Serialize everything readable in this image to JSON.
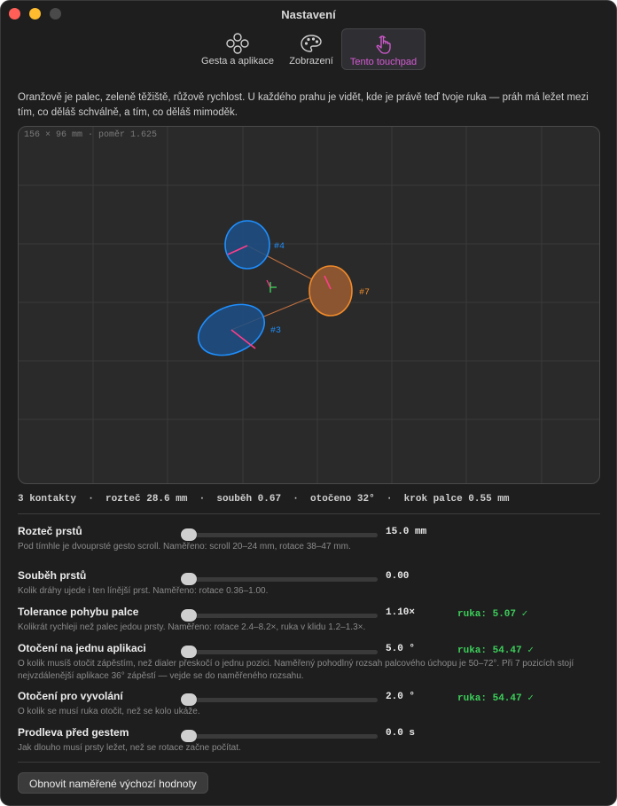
{
  "window": {
    "title": "Nastavení"
  },
  "tabs": [
    {
      "label": "Gesta a aplikace",
      "icon": "gestures-icon",
      "active": false
    },
    {
      "label": "Zobrazení",
      "icon": "palette-icon",
      "active": false
    },
    {
      "label": "Tento touchpad",
      "icon": "hand-pointer-icon",
      "active": true
    }
  ],
  "intro": "Oranžově je palec, zeleně těžiště, růžově rychlost. U každého prahu je vidět, kde je právě teď tvoje ruka — práh má ležet mezi tím, co děláš schválně, a tím, co děláš mimoděk.",
  "touchpad": {
    "caption": "156 × 96 mm · poměr 1.625",
    "contacts": [
      {
        "label": "#4",
        "role": "finger",
        "color": "#1e8fff"
      },
      {
        "label": "#3",
        "role": "finger",
        "color": "#1e8fff"
      },
      {
        "label": "#7",
        "role": "thumb",
        "color": "#f08a2a"
      }
    ],
    "centroid_color": "#3ccf5a",
    "velocity_color": "#ff3d8a"
  },
  "stats": "3 kontakty  ·  rozteč 28.6 mm  ·  souběh 0.67  ·  otočeno 32°  ·  krok palce 0.55 mm",
  "settings": [
    {
      "name": "Rozteč prstů",
      "value": "15.0 mm",
      "hand": "",
      "desc": "Pod tímhle je dvouprsté gesto scroll. Naměřeno: scroll 20–24 mm, rotace 38–47 mm."
    },
    {
      "name": "Souběh prstů",
      "value": "0.00",
      "hand": "",
      "desc": "Kolik dráhy ujede i ten línější prst. Naměřeno: rotace 0.36–1.00."
    },
    {
      "name": "Tolerance pohybu palce",
      "value": "1.10×",
      "hand": "ruka: 5.07 ✓",
      "desc": "Kolikrát rychleji než palec jedou prsty. Naměřeno: rotace 2.4–8.2×, ruka v klidu 1.2–1.3×."
    },
    {
      "name": "Otočení na jednu aplikaci",
      "value": "5.0 °",
      "hand": "ruka: 54.47 ✓",
      "desc": "O kolik musíš otočit zápěstím, než dialer přeskočí o jednu pozici. Naměřený pohodlný rozsah palcového úchopu je 50–72°.  Při 7 pozicích stojí nejvzdálenější aplikace 36° zápěstí — vejde se do naměřeného rozsahu."
    },
    {
      "name": "Otočení pro vyvolání",
      "value": "2.0 °",
      "hand": "ruka: 54.47 ✓",
      "desc": "O kolik se musí ruka otočit, než se kolo ukáže."
    },
    {
      "name": "Prodleva před gestem",
      "value": "0.0 s",
      "hand": "",
      "desc": "Jak dlouho musí prsty ležet, než se rotace začne počítat."
    }
  ],
  "reset_button": "Obnovit naměřené výchozí hodnoty"
}
